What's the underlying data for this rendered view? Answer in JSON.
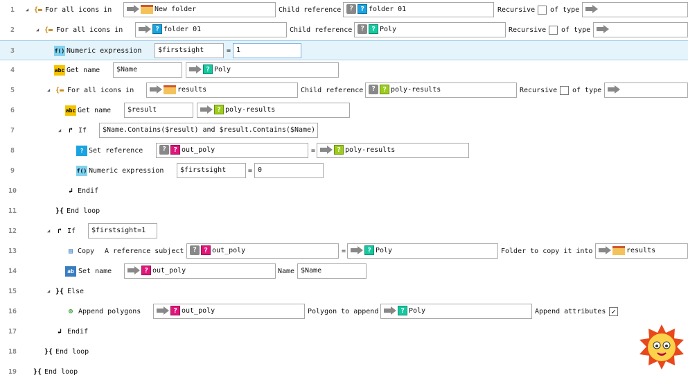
{
  "colors": {
    "selected_row": "#e5f3fb",
    "cyan_ref": "#1aa3e0",
    "green_ref": "#14c8a0",
    "lime_ref": "#9ccc1c",
    "magenta_ref": "#e0157a",
    "folder": "#f4c25a"
  },
  "rows": [
    {
      "number": "1",
      "icon": "for-loop-folder-icon",
      "label": "For all icons in",
      "expander": true,
      "fields": [
        {
          "kind": "ref",
          "arrow": "arrow",
          "icon": "folder",
          "value": "New folder"
        },
        {
          "kind": "label",
          "value": "Child reference"
        },
        {
          "kind": "ref",
          "arrow": "qref",
          "icon": "cyan",
          "value": "folder 01"
        },
        {
          "kind": "label",
          "value": "Recursive"
        },
        {
          "kind": "check",
          "checked": false
        },
        {
          "kind": "label",
          "value": "of type"
        },
        {
          "kind": "ref",
          "arrow": "arrow",
          "icon": "",
          "value": ""
        }
      ]
    },
    {
      "number": "2",
      "icon": "for-loop-folder-icon",
      "label": "For all icons in",
      "expander": true,
      "fields": [
        {
          "kind": "ref",
          "arrow": "arrow",
          "icon": "cyan",
          "value": "folder 01"
        },
        {
          "kind": "label",
          "value": "Child reference"
        },
        {
          "kind": "ref",
          "arrow": "qref",
          "icon": "green",
          "value": "Poly"
        },
        {
          "kind": "label",
          "value": "Recursive"
        },
        {
          "kind": "check",
          "checked": false
        },
        {
          "kind": "label",
          "value": "of type"
        },
        {
          "kind": "ref",
          "arrow": "arrow",
          "icon": "",
          "value": ""
        }
      ]
    },
    {
      "number": "3",
      "icon": "function-icon",
      "label": "Numeric expression",
      "selected": true,
      "fields": [
        {
          "kind": "text",
          "value": "$firstsight"
        },
        {
          "kind": "label",
          "value": "="
        },
        {
          "kind": "text",
          "value": "1",
          "focus": true
        }
      ]
    },
    {
      "number": "4",
      "icon": "abc-icon",
      "label": "Get name",
      "fields": [
        {
          "kind": "text",
          "value": "$Name"
        },
        {
          "kind": "ref",
          "arrow": "arrow",
          "icon": "green",
          "value": "Poly"
        }
      ]
    },
    {
      "number": "5",
      "icon": "for-loop-folder-icon",
      "label": "For all icons in",
      "expander": true,
      "fields": [
        {
          "kind": "ref",
          "arrow": "arrow",
          "icon": "folder",
          "value": "results"
        },
        {
          "kind": "label",
          "value": "Child reference"
        },
        {
          "kind": "ref",
          "arrow": "qref",
          "icon": "lime",
          "value": "poly-results"
        },
        {
          "kind": "label",
          "value": "Recursive"
        },
        {
          "kind": "check",
          "checked": false
        },
        {
          "kind": "label",
          "value": "of type"
        },
        {
          "kind": "ref",
          "arrow": "arrow",
          "icon": "",
          "value": ""
        }
      ]
    },
    {
      "number": "6",
      "icon": "abc-icon",
      "label": "Get name",
      "fields": [
        {
          "kind": "text",
          "value": "$result"
        },
        {
          "kind": "ref",
          "arrow": "arrow",
          "icon": "lime",
          "value": "poly-results"
        }
      ]
    },
    {
      "number": "7",
      "icon": "if-icon",
      "label": "If",
      "expander": true,
      "fields": [
        {
          "kind": "text",
          "value": "$Name.Contains($result) and $result.Contains($Name)"
        }
      ]
    },
    {
      "number": "8",
      "icon": "set-reference-icon",
      "label": "Set reference",
      "fields": [
        {
          "kind": "ref",
          "arrow": "qref",
          "icon": "magenta",
          "value": "out_poly"
        },
        {
          "kind": "label",
          "value": "="
        },
        {
          "kind": "ref",
          "arrow": "arrow",
          "icon": "lime",
          "value": "poly-results"
        }
      ]
    },
    {
      "number": "9",
      "icon": "function-icon",
      "label": "Numeric expression",
      "fields": [
        {
          "kind": "text",
          "value": "$firstsight"
        },
        {
          "kind": "label",
          "value": "="
        },
        {
          "kind": "text",
          "value": "0"
        }
      ]
    },
    {
      "number": "10",
      "icon": "endif-icon",
      "label": "Endif",
      "fields": []
    },
    {
      "number": "11",
      "icon": "end-loop-icon",
      "label": "End loop",
      "fields": []
    },
    {
      "number": "12",
      "icon": "if-icon",
      "label": "If",
      "expander": true,
      "fields": [
        {
          "kind": "text",
          "value": "$firstsight=1"
        }
      ]
    },
    {
      "number": "13",
      "icon": "copy-icon",
      "label": "Copy",
      "fields": [
        {
          "kind": "label",
          "value": "A reference subject"
        },
        {
          "kind": "ref",
          "arrow": "qref",
          "icon": "magenta",
          "value": "out_poly"
        },
        {
          "kind": "label",
          "value": "="
        },
        {
          "kind": "ref",
          "arrow": "arrow",
          "icon": "green",
          "value": "Poly"
        },
        {
          "kind": "label",
          "value": "Folder to copy it into"
        },
        {
          "kind": "ref",
          "arrow": "arrow",
          "icon": "folder",
          "value": "results"
        }
      ]
    },
    {
      "number": "14",
      "icon": "set-name-icon",
      "label": "Set name",
      "fields": [
        {
          "kind": "ref",
          "arrow": "arrow",
          "icon": "magenta",
          "value": "out_poly"
        },
        {
          "kind": "label",
          "value": "Name"
        },
        {
          "kind": "text",
          "value": "$Name"
        }
      ]
    },
    {
      "number": "15",
      "icon": "else-icon",
      "label": "Else",
      "expander": true,
      "fields": []
    },
    {
      "number": "16",
      "icon": "append-polygons-icon",
      "label": "Append polygons",
      "fields": [
        {
          "kind": "ref",
          "arrow": "arrow",
          "icon": "magenta",
          "value": "out_poly"
        },
        {
          "kind": "label",
          "value": "Polygon to append"
        },
        {
          "kind": "ref",
          "arrow": "arrow",
          "icon": "green",
          "value": "Poly"
        },
        {
          "kind": "label",
          "value": "Append attributes"
        },
        {
          "kind": "check",
          "checked": true
        }
      ]
    },
    {
      "number": "17",
      "icon": "endif-icon",
      "label": "Endif",
      "fields": []
    },
    {
      "number": "18",
      "icon": "end-loop-icon",
      "label": "End loop",
      "fields": []
    },
    {
      "number": "19",
      "icon": "end-loop-icon",
      "label": "End loop",
      "fields": []
    }
  ]
}
